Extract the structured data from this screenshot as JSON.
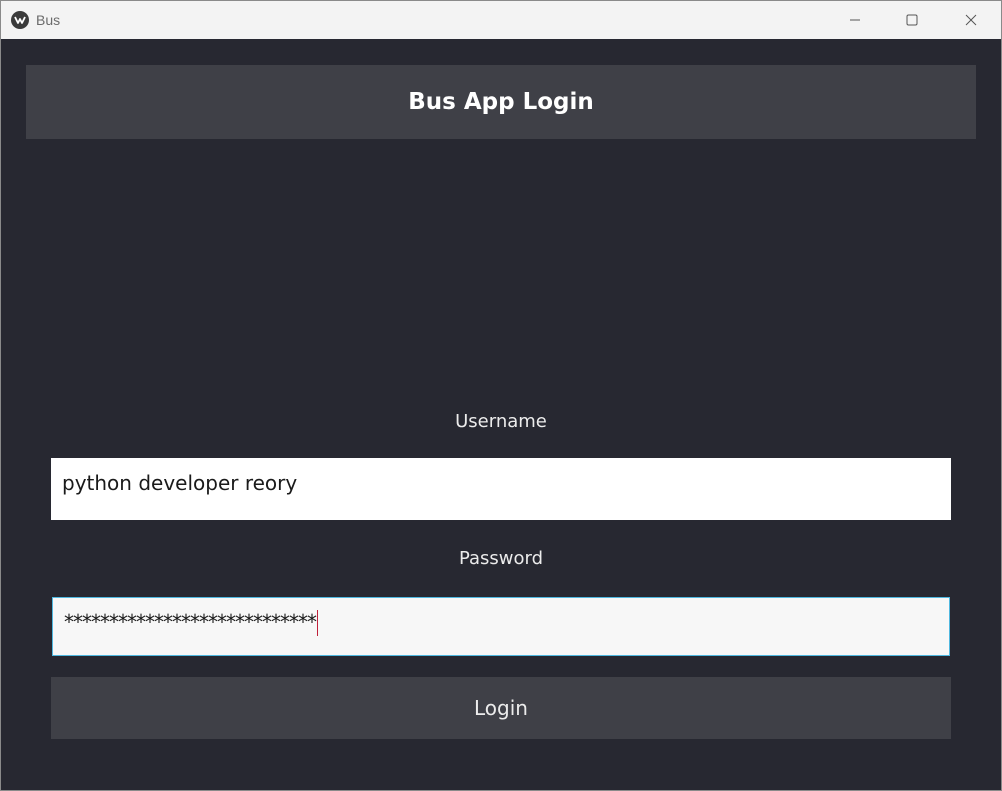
{
  "window": {
    "title": "Bus",
    "app_icon": "kivy-logo-icon",
    "controls": {
      "minimize_icon": "minimize-icon",
      "maximize_icon": "maximize-icon",
      "close_icon": "close-icon"
    }
  },
  "header": {
    "title": "Bus App Login"
  },
  "form": {
    "username_label": "Username",
    "username_value": "python developer reory",
    "password_label": "Password",
    "password_value": "****************************",
    "login_label": "Login"
  },
  "colors": {
    "background": "#272831",
    "header_bar": "#3f4047",
    "button": "#3f4047",
    "focus_border": "#4fb8e0",
    "caret": "#c0203a"
  }
}
